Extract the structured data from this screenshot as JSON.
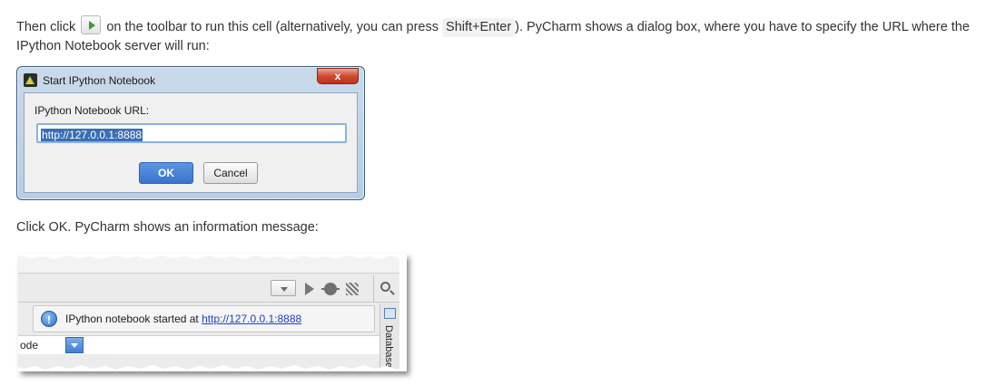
{
  "paragraph1": {
    "before_button": "Then click",
    "after_button": "on the toolbar to run this cell (alternatively, you can press",
    "shortcut": "Shift+Enter",
    "after_shortcut": "). PyCharm shows a dialog box, where you have to specify the URL where the IPython Notebook server will run:"
  },
  "dialog": {
    "title": "Start IPython Notebook",
    "close_label": "x",
    "field_label": "IPython Notebook URL:",
    "url_value": "http://127.0.0.1:8888",
    "ok_label": "OK",
    "cancel_label": "Cancel"
  },
  "paragraph2": {
    "text": "Click OK. PyCharm shows an information message:"
  },
  "ide": {
    "info_glyph": "!",
    "notification_text": "IPython notebook started at",
    "notification_link": "http://127.0.0.1:8888",
    "code_fragment": "ode",
    "side_tab_label": "Database"
  },
  "colors": {
    "link": "#1a3fcf",
    "ok_button": "#3b73cc",
    "selection": "#3a6fb6",
    "run_icon": "#3c9a3c"
  }
}
